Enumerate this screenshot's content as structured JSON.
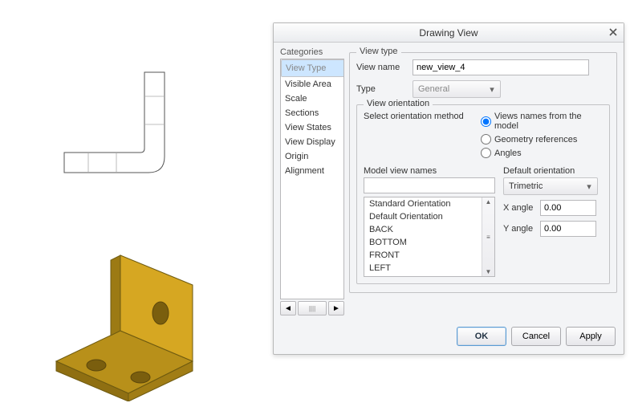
{
  "dialog": {
    "title": "Drawing View",
    "categories_label": "Categories",
    "categories": [
      "View Type",
      "Visible Area",
      "Scale",
      "Sections",
      "View States",
      "View Display",
      "Origin",
      "Alignment"
    ],
    "selected_category_index": 0,
    "view_type_heading": "View type",
    "view_name_label": "View name",
    "view_name_value": "new_view_4",
    "type_label": "Type",
    "type_value": "General",
    "orientation_legend": "View orientation",
    "orientation_method_label": "Select orientation method",
    "orientation_options": [
      "Views names from the model",
      "Geometry references",
      "Angles"
    ],
    "orientation_selected_index": 0,
    "model_view_names_label": "Model view names",
    "model_view_names_input": "",
    "model_view_names_list": [
      "Standard Orientation",
      "Default Orientation",
      "BACK",
      "BOTTOM",
      "FRONT",
      "LEFT"
    ],
    "default_orientation_label": "Default orientation",
    "default_orientation_value": "Trimetric",
    "x_angle_label": "X angle",
    "x_angle_value": "0.00",
    "y_angle_label": "Y angle",
    "y_angle_value": "0.00",
    "buttons": {
      "ok": "OK",
      "cancel": "Cancel",
      "apply": "Apply"
    }
  }
}
